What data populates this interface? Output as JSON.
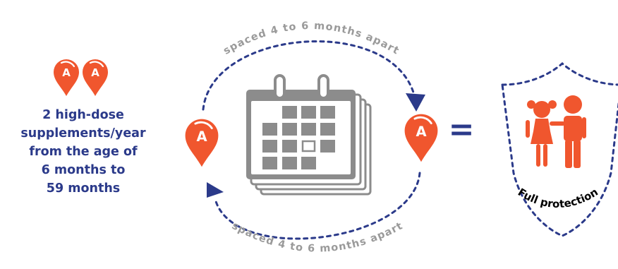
{
  "pin_letter": "A",
  "description_lines": [
    "2 high-dose",
    "supplements/year",
    "from the age of",
    "6 months to",
    "59 months"
  ],
  "top_arc_label": "spaced 4 to 6 months apart",
  "bottom_arc_label": "spaced 4 to 6 months apart",
  "equals_sign": "=",
  "shield_label": "Full protection",
  "icons": {
    "pins": "map-pin-icon",
    "calendar": "calendar-stack-icon",
    "children": "children-icon",
    "shield": "shield-icon"
  },
  "colors": {
    "accent_orange": "#f0562e",
    "navy": "#2b3a8a",
    "calendar_gray": "#8c8c8c"
  }
}
